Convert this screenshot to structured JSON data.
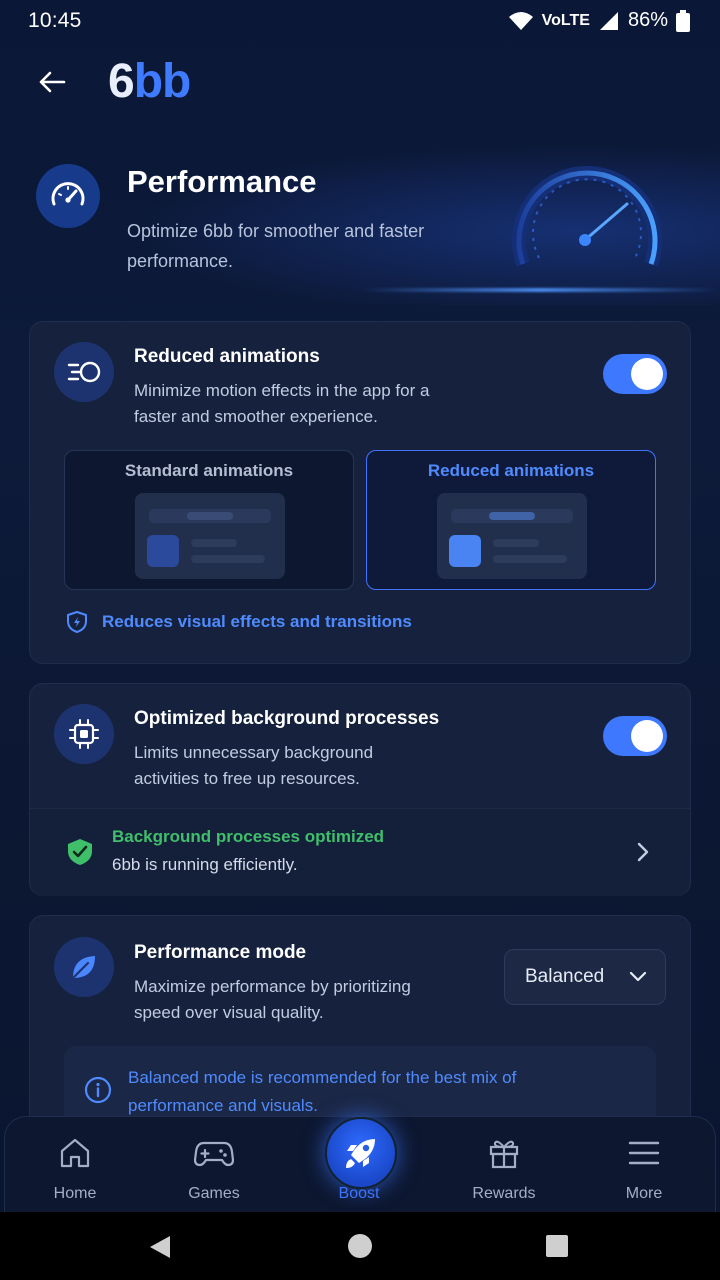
{
  "status_bar": {
    "time": "10:45",
    "network": "VoLTE",
    "battery": "86%"
  },
  "header": {
    "logo_six": "6",
    "logo_bb": "bb"
  },
  "hero": {
    "title": "Performance",
    "subtitle": "Optimize 6bb for smoother and faster performance."
  },
  "reduced_animations": {
    "title": "Reduced animations",
    "description": "Minimize motion effects in the app for a faster and smoother experience.",
    "toggle_on": true,
    "option_standard": "Standard animations",
    "option_reduced": "Reduced animations",
    "selected": "reduced",
    "note": "Reduces visual effects and transitions"
  },
  "background_processes": {
    "title": "Optimized background processes",
    "description": "Limits unnecessary background activities to free up resources.",
    "toggle_on": true,
    "status_title": "Background processes optimized",
    "status_sub": "6bb is running efficiently."
  },
  "performance_mode": {
    "title": "Performance mode",
    "description": "Maximize performance by prioritizing speed over visual quality.",
    "selected_value": "Balanced",
    "info": "Balanced mode is recommended for the best mix of performance and visuals."
  },
  "bottom_nav": {
    "items": [
      {
        "label": "Home",
        "icon": "home-icon"
      },
      {
        "label": "Games",
        "icon": "gamepad-icon"
      },
      {
        "label": "Boost",
        "icon": "rocket-icon",
        "active": true
      },
      {
        "label": "Rewards",
        "icon": "gift-icon"
      },
      {
        "label": "More",
        "icon": "menu-icon"
      }
    ]
  },
  "colors": {
    "accent": "#3e74ff",
    "success": "#3fbf6a",
    "background": "#0b1736",
    "card": "#16223d"
  }
}
